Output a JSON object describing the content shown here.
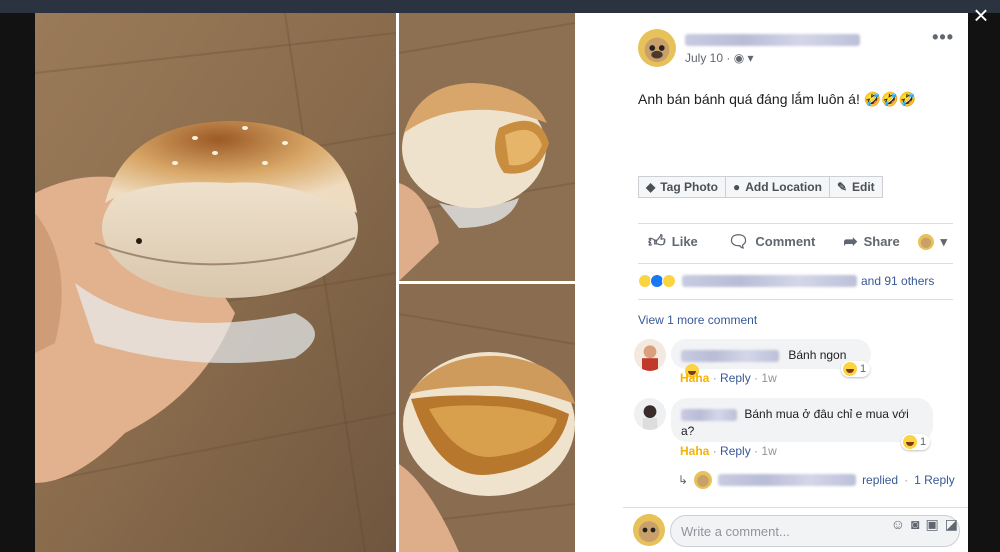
{
  "viewer": {
    "close_icon": "close-icon"
  },
  "post": {
    "date": "July 10",
    "audience_icon": "globe-icon",
    "text": "Anh bán bánh quá đáng lắm luôn á! 🤣🤣🤣",
    "options_icon": "more-options-icon",
    "pills": [
      {
        "label": "Tag Photo",
        "icon": "tag-icon"
      },
      {
        "label": "Add Location",
        "icon": "location-pin-icon"
      },
      {
        "label": "Edit",
        "icon": "pencil-icon"
      }
    ],
    "actions": {
      "like": "Like",
      "comment": "Comment",
      "share": "Share"
    },
    "reactions": {
      "others_text": "and 91 others"
    },
    "view_more": "View 1 more comment"
  },
  "comments": [
    {
      "text": "Bánh ngon",
      "haha": "Haha",
      "reply": "Reply",
      "time": "1w",
      "reaction_count": "1"
    },
    {
      "text": "Bánh mua ở đâu chỉ e mua với a?",
      "haha": "Haha",
      "reply": "Reply",
      "time": "1w",
      "reaction_count": "1"
    }
  ],
  "reply_summary": {
    "replied": "replied",
    "sep": "·",
    "count": "1 Reply"
  },
  "composer": {
    "placeholder": "Write a comment..."
  },
  "colors": {
    "link": "#385898",
    "haha": "#f5b300",
    "like_blue": "#1877f2",
    "panel_bg": "#ffffff",
    "backdrop": "#121212"
  }
}
